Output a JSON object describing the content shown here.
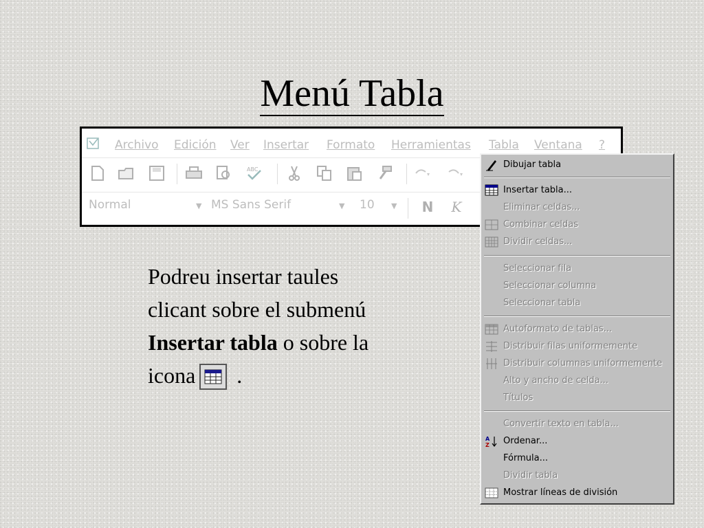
{
  "title": "Menú Tabla",
  "menubar": {
    "items": [
      "Archivo",
      "Edición",
      "Ver",
      "Insertar",
      "Formato",
      "Herramientas",
      "Tabla",
      "Ventana",
      "?"
    ]
  },
  "toolbar": {
    "icons": [
      "new-document-icon",
      "open-folder-icon",
      "save-icon",
      "print-icon",
      "print-preview-icon",
      "spelling-icon",
      "cut-icon",
      "copy-icon",
      "paste-icon",
      "format-painter-icon",
      "undo-icon",
      "redo-icon"
    ],
    "style_value": "Normal",
    "font_value": "MS Sans Serif",
    "size_value": "10",
    "bold_label": "N",
    "italic_label": "K"
  },
  "paragraph": {
    "line1": "Podreu insertar taules",
    "line2": "clicant sobre el submenú",
    "bold": "Insertar tabla",
    "line3_rest": " o sobre la",
    "line4_start": "icona",
    "line4_end": "."
  },
  "menu": {
    "items": [
      {
        "label": "Dibujar tabla",
        "enabled": true,
        "icon": "pencil-icon"
      },
      {
        "label": "Insertar tabla...",
        "enabled": true,
        "icon": "insert-table-icon"
      },
      {
        "label": "Eliminar celdas...",
        "enabled": false,
        "icon": ""
      },
      {
        "label": "Combinar celdas",
        "enabled": false,
        "icon": "merge-cells-icon"
      },
      {
        "label": "Dividir celdas...",
        "enabled": false,
        "icon": "split-cells-icon"
      },
      {
        "label": "Seleccionar fila",
        "enabled": false,
        "icon": ""
      },
      {
        "label": "Seleccionar columna",
        "enabled": false,
        "icon": ""
      },
      {
        "label": "Seleccionar tabla",
        "enabled": false,
        "icon": ""
      },
      {
        "label": "Autoformato de tablas...",
        "enabled": false,
        "icon": "table-autoformat-icon"
      },
      {
        "label": "Distribuir filas uniformemente",
        "enabled": false,
        "icon": "distribute-rows-icon"
      },
      {
        "label": "Distribuir columnas uniformemente",
        "enabled": false,
        "icon": "distribute-columns-icon"
      },
      {
        "label": "Alto y ancho de celda...",
        "enabled": false,
        "icon": ""
      },
      {
        "label": "Títulos",
        "enabled": false,
        "icon": ""
      },
      {
        "label": "Convertir texto en tabla...",
        "enabled": false,
        "icon": ""
      },
      {
        "label": "Ordenar...",
        "enabled": true,
        "icon": "sort-az-icon"
      },
      {
        "label": "Fórmula...",
        "enabled": true,
        "icon": ""
      },
      {
        "label": "Dividir tabla",
        "enabled": false,
        "icon": ""
      },
      {
        "label": "Mostrar líneas de división",
        "enabled": true,
        "icon": "gridlines-icon"
      }
    ]
  }
}
